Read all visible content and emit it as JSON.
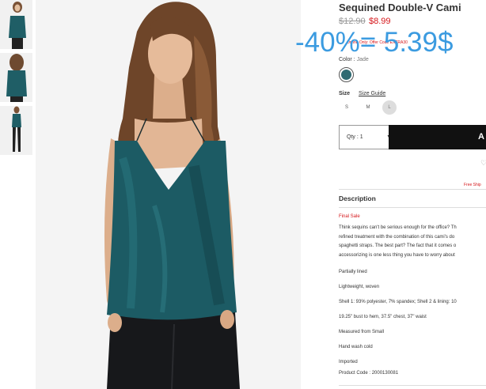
{
  "product": {
    "title": "Sequined Double-V Cami",
    "old_price": "$12.90",
    "new_price": "$8.99",
    "promo_line": "Online Only: Offer Code EXTRA30",
    "overlay": "-40%= 5.39$"
  },
  "color": {
    "label": "Color :",
    "value": "Jade",
    "swatch": "#2f6a72"
  },
  "size": {
    "label": "Size",
    "guide": "Size Guide",
    "options": [
      "S",
      "M",
      "L"
    ],
    "selected": "L"
  },
  "qty": {
    "label": "Qty : 1"
  },
  "add_button": {
    "label": "A"
  },
  "free_shipping": "Free Ship",
  "description": {
    "heading": "Description",
    "final_sale": "Final Sale",
    "lines": [
      "Think sequins can't be serious enough for the office? Th",
      "refined treatment with the combination of this cami's do",
      "spaghetti straps. The best part? The fact that it comes o",
      "accessorizing is one less thing you have to worry about"
    ],
    "details": [
      "Partially lined",
      "Lightweight, woven",
      "Shell 1: 93% polyester, 7% spandex; Shell 2 & lining: 10",
      "19.25\" bust to hem, 37.5\" chest, 37\" waist",
      "Measured from Small",
      "Hand wash cold",
      "Imported",
      "Product Code : 2000130081"
    ]
  }
}
